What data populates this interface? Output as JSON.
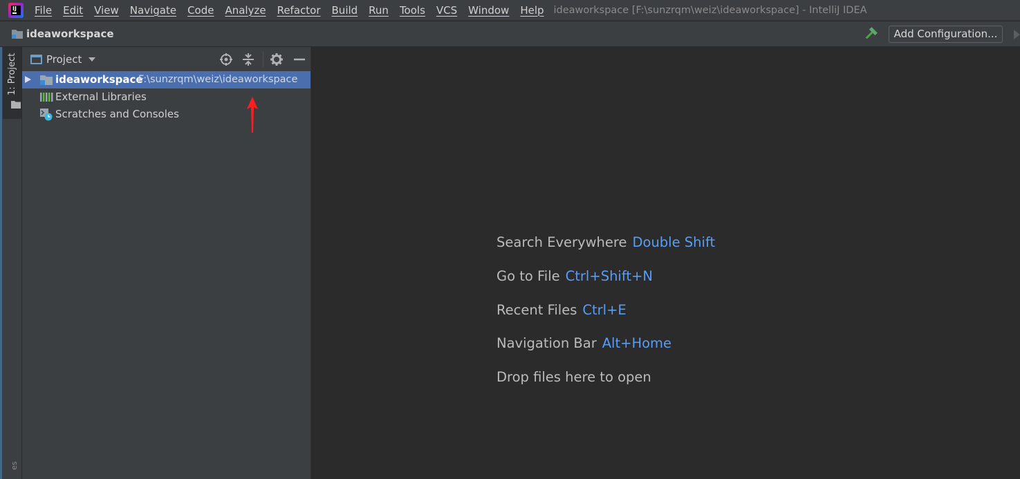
{
  "titlebar": {
    "app_logo_icon": "intellij-idea-icon",
    "menu": [
      "File",
      "Edit",
      "View",
      "Navigate",
      "Code",
      "Analyze",
      "Refactor",
      "Build",
      "Run",
      "Tools",
      "VCS",
      "Window",
      "Help"
    ],
    "window_title": "ideaworkspace [F:\\sunzrqm\\weiz\\ideaworkspace] - IntelliJ IDEA"
  },
  "navbar": {
    "project_name": "ideaworkspace",
    "build_icon": "hammer-icon",
    "add_configuration_label": "Add Configuration..."
  },
  "tool_stripe": {
    "project_tab_label": "1: Project",
    "bottom_partial_text": "es"
  },
  "project_panel": {
    "title": "Project",
    "toolbar_icons": [
      "locate-icon",
      "collapse-all-icon",
      "gear-icon",
      "hide-icon"
    ],
    "tree": [
      {
        "label": "ideaworkspace",
        "path": "F:\\sunzrqm\\weiz\\ideaworkspace",
        "selected": true,
        "expandable": true,
        "icon": "module-folder-icon"
      },
      {
        "label": "External Libraries",
        "selected": false,
        "expandable": false,
        "icon": "libraries-icon"
      },
      {
        "label": "Scratches and Consoles",
        "selected": false,
        "expandable": false,
        "icon": "scratches-icon"
      }
    ]
  },
  "annotation": {
    "icon": "red-arrow-annotation",
    "color": "#ff1e1e"
  },
  "editor": {
    "hints": [
      {
        "text": "Search Everywhere",
        "key": "Double Shift"
      },
      {
        "text": "Go to File",
        "key": "Ctrl+Shift+N"
      },
      {
        "text": "Recent Files",
        "key": "Ctrl+E"
      },
      {
        "text": "Navigation Bar",
        "key": "Alt+Home"
      },
      {
        "text": "Drop files here to open",
        "key": ""
      }
    ]
  },
  "colors": {
    "panel_bg": "#3c3f41",
    "editor_bg": "#2b2b2b",
    "selection": "#4b6eaf",
    "shortcut_blue": "#589df6"
  }
}
